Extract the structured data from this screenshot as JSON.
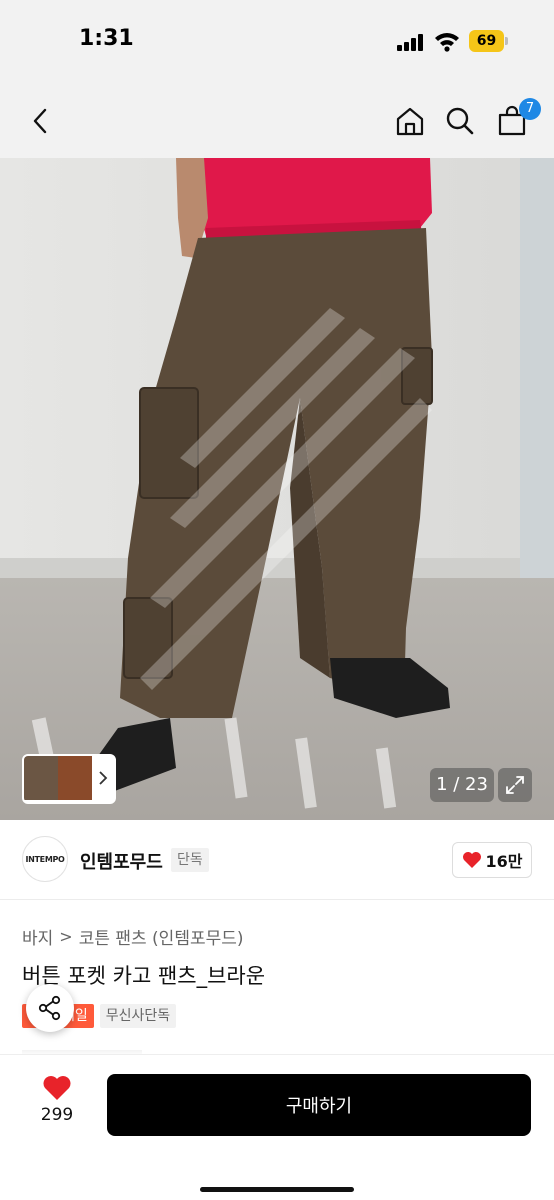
{
  "status_bar": {
    "time": "1:31",
    "battery_level": "69",
    "icons": [
      "signal-icon",
      "wifi-icon",
      "battery-icon"
    ]
  },
  "nav": {
    "icons": [
      "back-arrow-icon",
      "home-icon",
      "search-icon",
      "shopping-bag-icon"
    ],
    "cart_count": "7"
  },
  "gallery": {
    "counter": "1 / 23",
    "icons": [
      "chevron-right-icon",
      "expand-icon"
    ]
  },
  "brand": {
    "logo_text": "INTEMPO",
    "name": "인템포무드",
    "tag": "단독",
    "likes": "16만"
  },
  "product": {
    "breadcrumb": [
      "바지",
      "코튼 팬츠 (인템포무드)"
    ],
    "title": "버튼 포켓 카고 팬츠_브라운",
    "tags": {
      "sale": "세일",
      "exclusive": "무신사단독"
    }
  },
  "bottom_bar": {
    "wish_count": "299",
    "buy_label": "구매하기"
  },
  "colors": {
    "accent_blue": "#1e88e5",
    "sale_red": "#ff5a3a",
    "heart_red": "#e8232a",
    "battery_yellow": "#f5c518",
    "buy_button": "#000000"
  }
}
